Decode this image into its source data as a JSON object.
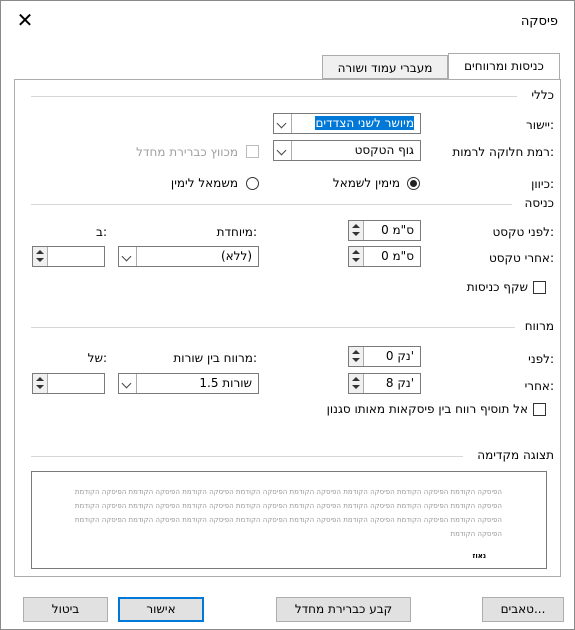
{
  "window": {
    "title": "פיסקה",
    "close_glyph": "✕"
  },
  "tabs": [
    {
      "label": "כניסות ומרווחים"
    },
    {
      "label": "מעברי עמוד ושורה"
    }
  ],
  "general": {
    "section_title": "כללי",
    "alignment_label": "יישור:",
    "alignment_value": "מיושר לשני הצדדים",
    "outline_label": "רמת חלוקה לרמות:",
    "outline_value": "גוף הטקסט",
    "collapsed_label": "מכווץ כברירת מחדל",
    "direction_label": "כיוון:",
    "rtl_label": "מימין לשמאל",
    "ltr_label": "משמאל לימין"
  },
  "indent": {
    "section_title": "כניסה",
    "before_label": "לפני טקסט:",
    "before_value": "0 ס\"מ",
    "after_label": "אחרי טקסט:",
    "after_value": "0 ס\"מ",
    "special_label": "מיוחדת:",
    "special_value": "(ללא)",
    "by_label": "ב:",
    "by_value": "",
    "mirror_label": "שקף כניסות"
  },
  "spacing": {
    "section_title": "מרווח",
    "before_label": "לפני:",
    "before_value": "0 נק'",
    "after_label": "אחרי:",
    "after_value": "8 נק'",
    "line_label": "מרווח בין שורות:",
    "line_value": "1.5 שורות",
    "at_label": "של:",
    "at_value": "",
    "dont_add_label": "אל תוסיף רווח בין פיסקאות מאותו סגנון"
  },
  "preview": {
    "section_title": "תצוגה מקדימה",
    "lines": [
      "הפיסקה הקודמת הפיסקה הקודמת הפיסקה הקודמת הפיסקה הקודמת הפיסקה הקודמת הפיסקה הקודמת הפיסקה הקודמת הפיסקה הקודמת",
      "הפיסקה הקודמת הפיסקה הקודמת הפיסקה הקודמת הפיסקה הקודמת הפיסקה הקודמת הפיסקה הקודמת הפיסקה הקודמת הפיסקה הקודמת",
      "הפיסקה הקודמת הפיסקה הקודמת הפיסקה הקודמת הפיסקה הקודמת הפיסקה הקודמת הפיסקה הקודמת הפיסקה הקודמת הפיסקה הקודמת",
      "הפיסקה הקודמת"
    ],
    "sample_word": "נאוז"
  },
  "buttons": {
    "tabs": "טאבים...",
    "set_default": "קבע כברירת מחדל",
    "ok": "אישור",
    "cancel": "ביטול"
  },
  "colors": {
    "accent": "#0078d7"
  }
}
